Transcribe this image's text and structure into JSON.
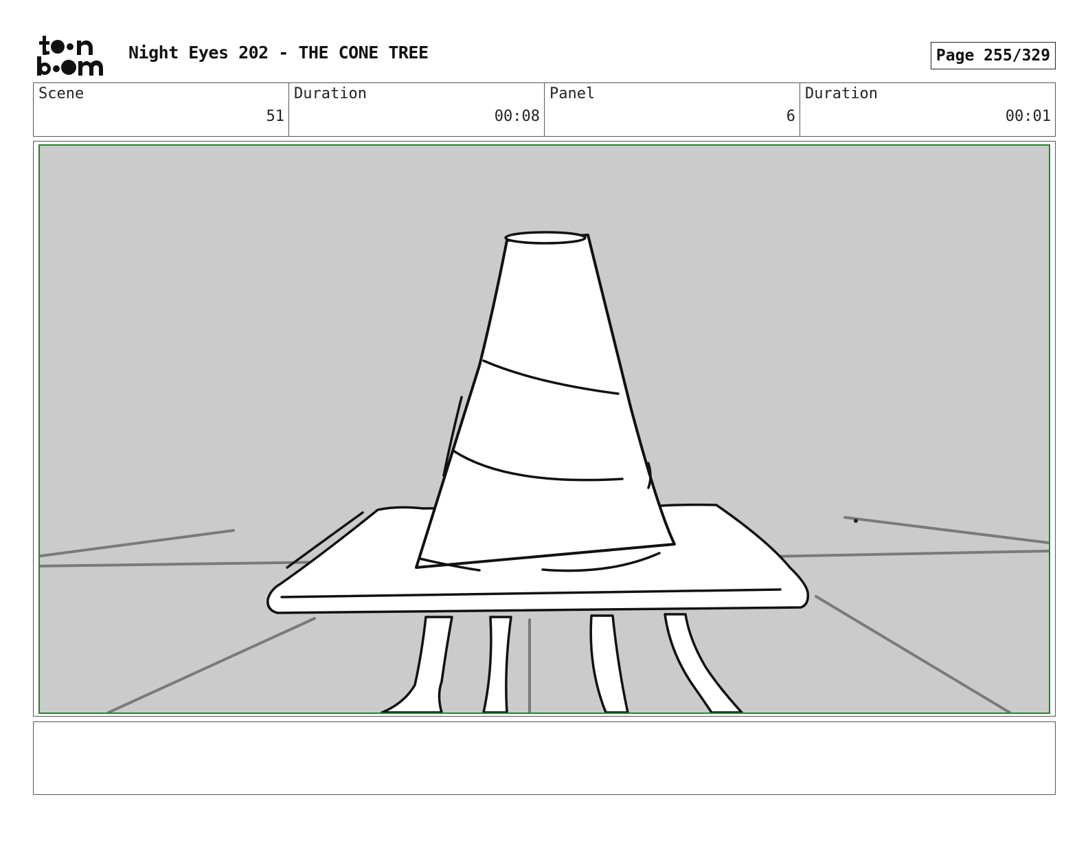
{
  "header": {
    "logo_text": "toon boom",
    "title": "Night Eyes 202 - THE CONE TREE",
    "page_label": "Page 255/329"
  },
  "info": {
    "scene_label": "Scene",
    "scene_value": "51",
    "scene_duration_label": "Duration",
    "scene_duration_value": "00:08",
    "panel_label": "Panel",
    "panel_value": "6",
    "panel_duration_label": "Duration",
    "panel_duration_value": "00:01"
  },
  "panel": {
    "background_color": "#cbcbcb",
    "frame_color": "#2e7d32"
  },
  "notes": {
    "text": ""
  }
}
